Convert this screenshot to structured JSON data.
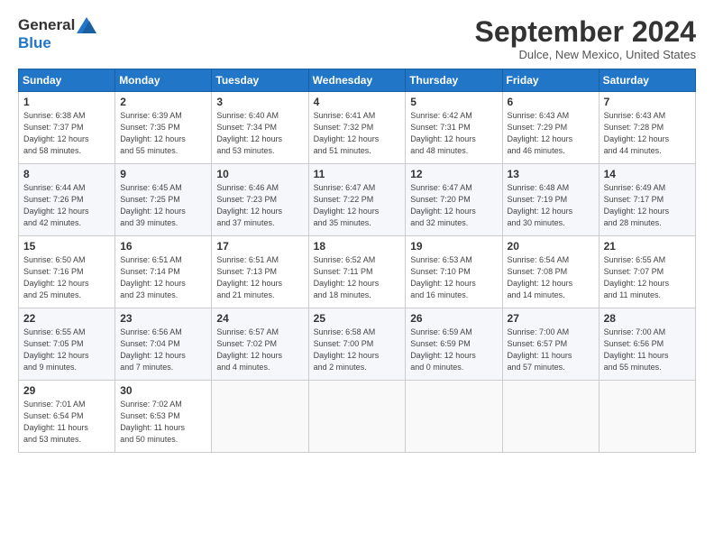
{
  "header": {
    "logo_general": "General",
    "logo_blue": "Blue",
    "month_title": "September 2024",
    "location": "Dulce, New Mexico, United States"
  },
  "weekdays": [
    "Sunday",
    "Monday",
    "Tuesday",
    "Wednesday",
    "Thursday",
    "Friday",
    "Saturday"
  ],
  "weeks": [
    [
      {
        "day": "1",
        "info": "Sunrise: 6:38 AM\nSunset: 7:37 PM\nDaylight: 12 hours\nand 58 minutes."
      },
      {
        "day": "2",
        "info": "Sunrise: 6:39 AM\nSunset: 7:35 PM\nDaylight: 12 hours\nand 55 minutes."
      },
      {
        "day": "3",
        "info": "Sunrise: 6:40 AM\nSunset: 7:34 PM\nDaylight: 12 hours\nand 53 minutes."
      },
      {
        "day": "4",
        "info": "Sunrise: 6:41 AM\nSunset: 7:32 PM\nDaylight: 12 hours\nand 51 minutes."
      },
      {
        "day": "5",
        "info": "Sunrise: 6:42 AM\nSunset: 7:31 PM\nDaylight: 12 hours\nand 48 minutes."
      },
      {
        "day": "6",
        "info": "Sunrise: 6:43 AM\nSunset: 7:29 PM\nDaylight: 12 hours\nand 46 minutes."
      },
      {
        "day": "7",
        "info": "Sunrise: 6:43 AM\nSunset: 7:28 PM\nDaylight: 12 hours\nand 44 minutes."
      }
    ],
    [
      {
        "day": "8",
        "info": "Sunrise: 6:44 AM\nSunset: 7:26 PM\nDaylight: 12 hours\nand 42 minutes."
      },
      {
        "day": "9",
        "info": "Sunrise: 6:45 AM\nSunset: 7:25 PM\nDaylight: 12 hours\nand 39 minutes."
      },
      {
        "day": "10",
        "info": "Sunrise: 6:46 AM\nSunset: 7:23 PM\nDaylight: 12 hours\nand 37 minutes."
      },
      {
        "day": "11",
        "info": "Sunrise: 6:47 AM\nSunset: 7:22 PM\nDaylight: 12 hours\nand 35 minutes."
      },
      {
        "day": "12",
        "info": "Sunrise: 6:47 AM\nSunset: 7:20 PM\nDaylight: 12 hours\nand 32 minutes."
      },
      {
        "day": "13",
        "info": "Sunrise: 6:48 AM\nSunset: 7:19 PM\nDaylight: 12 hours\nand 30 minutes."
      },
      {
        "day": "14",
        "info": "Sunrise: 6:49 AM\nSunset: 7:17 PM\nDaylight: 12 hours\nand 28 minutes."
      }
    ],
    [
      {
        "day": "15",
        "info": "Sunrise: 6:50 AM\nSunset: 7:16 PM\nDaylight: 12 hours\nand 25 minutes."
      },
      {
        "day": "16",
        "info": "Sunrise: 6:51 AM\nSunset: 7:14 PM\nDaylight: 12 hours\nand 23 minutes."
      },
      {
        "day": "17",
        "info": "Sunrise: 6:51 AM\nSunset: 7:13 PM\nDaylight: 12 hours\nand 21 minutes."
      },
      {
        "day": "18",
        "info": "Sunrise: 6:52 AM\nSunset: 7:11 PM\nDaylight: 12 hours\nand 18 minutes."
      },
      {
        "day": "19",
        "info": "Sunrise: 6:53 AM\nSunset: 7:10 PM\nDaylight: 12 hours\nand 16 minutes."
      },
      {
        "day": "20",
        "info": "Sunrise: 6:54 AM\nSunset: 7:08 PM\nDaylight: 12 hours\nand 14 minutes."
      },
      {
        "day": "21",
        "info": "Sunrise: 6:55 AM\nSunset: 7:07 PM\nDaylight: 12 hours\nand 11 minutes."
      }
    ],
    [
      {
        "day": "22",
        "info": "Sunrise: 6:55 AM\nSunset: 7:05 PM\nDaylight: 12 hours\nand 9 minutes."
      },
      {
        "day": "23",
        "info": "Sunrise: 6:56 AM\nSunset: 7:04 PM\nDaylight: 12 hours\nand 7 minutes."
      },
      {
        "day": "24",
        "info": "Sunrise: 6:57 AM\nSunset: 7:02 PM\nDaylight: 12 hours\nand 4 minutes."
      },
      {
        "day": "25",
        "info": "Sunrise: 6:58 AM\nSunset: 7:00 PM\nDaylight: 12 hours\nand 2 minutes."
      },
      {
        "day": "26",
        "info": "Sunrise: 6:59 AM\nSunset: 6:59 PM\nDaylight: 12 hours\nand 0 minutes."
      },
      {
        "day": "27",
        "info": "Sunrise: 7:00 AM\nSunset: 6:57 PM\nDaylight: 11 hours\nand 57 minutes."
      },
      {
        "day": "28",
        "info": "Sunrise: 7:00 AM\nSunset: 6:56 PM\nDaylight: 11 hours\nand 55 minutes."
      }
    ],
    [
      {
        "day": "29",
        "info": "Sunrise: 7:01 AM\nSunset: 6:54 PM\nDaylight: 11 hours\nand 53 minutes."
      },
      {
        "day": "30",
        "info": "Sunrise: 7:02 AM\nSunset: 6:53 PM\nDaylight: 11 hours\nand 50 minutes."
      },
      {
        "day": "",
        "info": ""
      },
      {
        "day": "",
        "info": ""
      },
      {
        "day": "",
        "info": ""
      },
      {
        "day": "",
        "info": ""
      },
      {
        "day": "",
        "info": ""
      }
    ]
  ]
}
